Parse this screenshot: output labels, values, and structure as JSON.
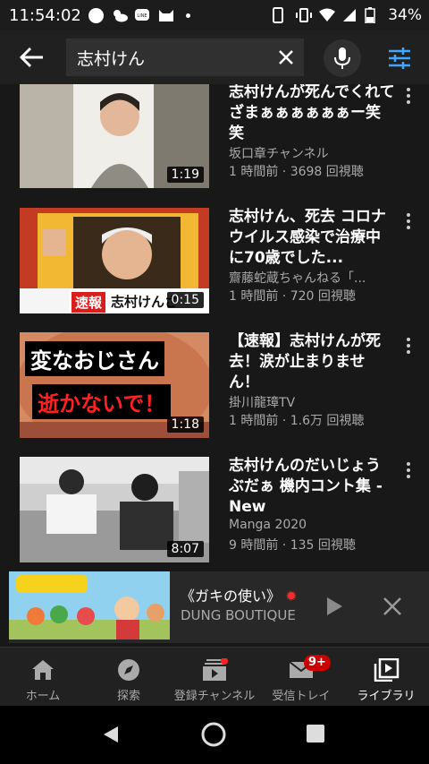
{
  "status": {
    "time": "11:54:02",
    "battery": "34%"
  },
  "search": {
    "query": "志村けん"
  },
  "results": [
    {
      "title": "志村けんが死んでくれてざまぁぁぁぁぁぁー笑笑",
      "channel": "坂口章チャンネル",
      "meta": "1 時間前 · 3698 回視聴",
      "duration": "1:19"
    },
    {
      "title": "志村けん、死去 コロナウイルス感染で治療中に70歳でした...",
      "channel": "齋藤蛇蔵ちゃんねる「...",
      "meta": "1 時間前 · 720 回視聴",
      "duration": "0:15",
      "thumb_text": [
        "速報",
        "志村けんさ"
      ]
    },
    {
      "title": "【速報】志村けんが死去！涙が止まりません！",
      "channel": "掛川龍璋TV",
      "meta": "1 時間前 · 1.6万 回視聴",
      "duration": "1:18",
      "thumb_text": [
        "変なおじさん",
        "逝かないで！"
      ]
    },
    {
      "title": "志村けんのだいじょうぶだぁ 機内コント集 - New",
      "channel": "Manga 2020",
      "meta": "9 時間前 · 135 回視聴",
      "duration": "8:07"
    }
  ],
  "miniplayer": {
    "title": "《ガキの使い》",
    "channel": "DUNG BOUTIQUE"
  },
  "nav": {
    "home": "ホーム",
    "explore": "探索",
    "subscriptions": "登録チャンネル",
    "inbox": "受信トレイ",
    "inbox_badge": "9+",
    "library": "ライブラリ"
  },
  "colors": {
    "background": "#181818",
    "accent_blue": "#3ea6ff",
    "badge_red": "#cc0000"
  }
}
